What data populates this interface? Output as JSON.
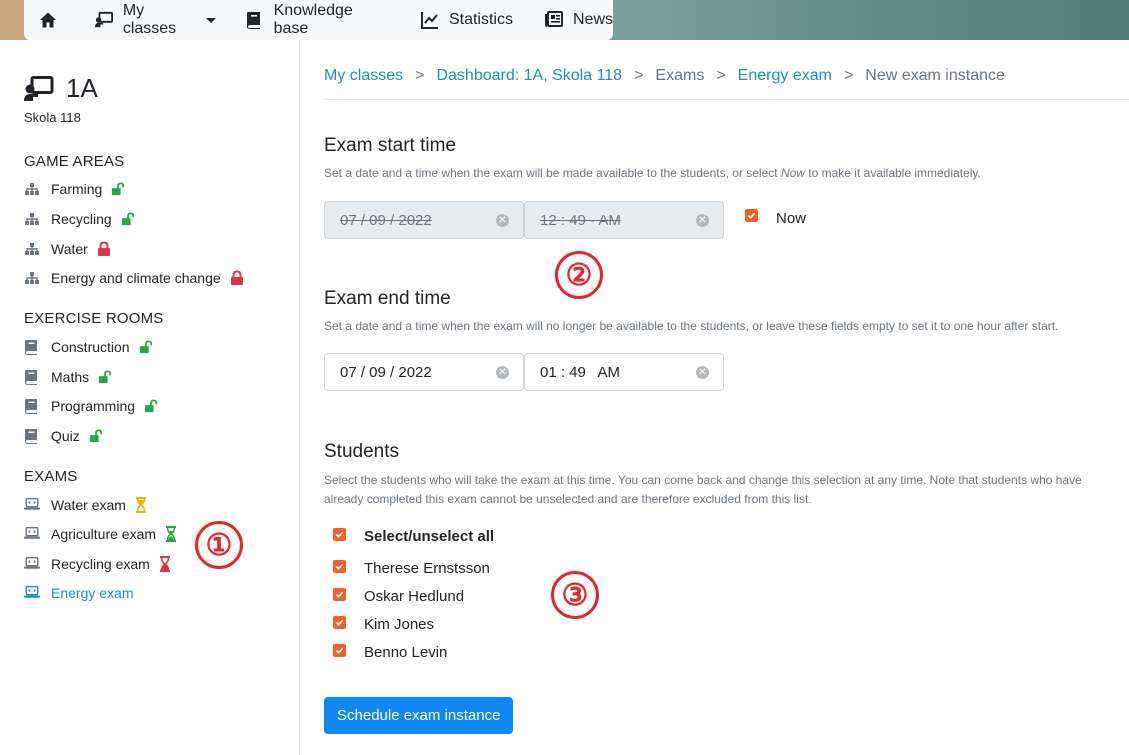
{
  "nav": {
    "home_icon": "home-icon",
    "items": [
      {
        "label": "My classes",
        "icon": "classroom-icon",
        "dropdown": true
      },
      {
        "label": "Knowledge base",
        "icon": "book-icon"
      },
      {
        "label": "Statistics",
        "icon": "chart-line-icon"
      },
      {
        "label": "News",
        "icon": "newspaper-icon"
      }
    ]
  },
  "sidebar": {
    "class_name": "1A",
    "school": "Skola 118",
    "game_areas": {
      "heading": "GAME AREAS",
      "items": [
        {
          "label": "Farming",
          "status": "unlocked"
        },
        {
          "label": "Recycling",
          "status": "unlocked"
        },
        {
          "label": "Water",
          "status": "locked"
        },
        {
          "label": "Energy and climate change",
          "status": "locked"
        }
      ]
    },
    "exercise_rooms": {
      "heading": "EXERCISE ROOMS",
      "items": [
        {
          "label": "Construction",
          "status": "unlocked"
        },
        {
          "label": "Maths",
          "status": "unlocked"
        },
        {
          "label": "Programming",
          "status": "unlocked"
        },
        {
          "label": "Quiz",
          "status": "unlocked"
        }
      ]
    },
    "exams": {
      "heading": "EXAMS",
      "items": [
        {
          "label": "Water exam",
          "status": "pending"
        },
        {
          "label": "Agriculture exam",
          "status": "active"
        },
        {
          "label": "Recycling exam",
          "status": "ended"
        },
        {
          "label": "Energy exam",
          "status": "selected"
        }
      ]
    }
  },
  "breadcrumb": {
    "items": [
      "My classes",
      "Dashboard: 1A, Skola 118",
      "Exams",
      "Energy exam",
      "New exam instance"
    ],
    "separator": ">"
  },
  "start": {
    "heading": "Exam start time",
    "help_pre": "Set a date and a time when the exam will be made available to the students, or select ",
    "help_em": "Now",
    "help_post": " to make it available immediately.",
    "date_value": "07 / 09 / 2022",
    "time_value": "12 : 49 - AM",
    "now_label": "Now",
    "now_checked": true
  },
  "end": {
    "heading": "Exam end time",
    "help": "Set a date and a time when the exam will no longer be available to the students, or leave these fields empty to set it to one hour after start.",
    "date_value": "07 / 09 / 2022",
    "time_value": "01 : 49   AM"
  },
  "students": {
    "heading": "Students",
    "help": "Select the students who will take the exam at this time. You can come back and change this selection at any time. Note that students who have already completed this exam cannot be unselected and are therefore excluded from this list.",
    "select_all_label": "Select/unselect all",
    "list": [
      "Therese Ernstsson",
      "Oskar Hedlund",
      "Kim Jones",
      "Benno Levin"
    ]
  },
  "submit_label": "Schedule exam instance",
  "annotations": [
    "①",
    "②",
    "③"
  ],
  "colors": {
    "accent": "#1f8bc9",
    "primary_button": "#1087f5",
    "checkbox": "#f0602a",
    "unlocked": "#28a745",
    "locked": "#dc3545",
    "pending": "#f0b400",
    "annotation": "#e3262b"
  }
}
